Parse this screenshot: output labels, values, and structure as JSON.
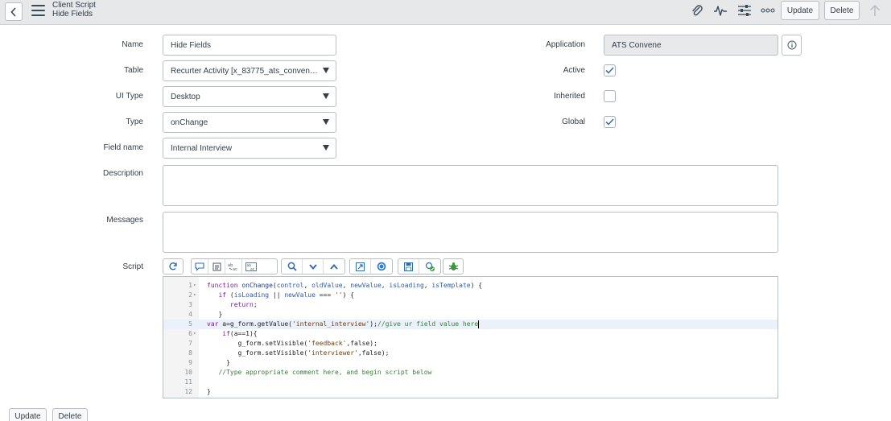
{
  "header": {
    "title": "Client Script",
    "subtitle": "Hide Fields",
    "update_label": "Update",
    "delete_label": "Delete"
  },
  "form": {
    "name_label": "Name",
    "name_value": "Hide Fields",
    "table_label": "Table",
    "table_value": "Recurter Activity [x_83775_ats_conven_r...",
    "ui_type_label": "UI Type",
    "ui_type_value": "Desktop",
    "type_label": "Type",
    "type_value": "onChange",
    "field_name_label": "Field name",
    "field_name_value": "Internal Interview",
    "description_label": "Description",
    "messages_label": "Messages",
    "script_label": "Script",
    "application_label": "Application",
    "application_value": "ATS Convene",
    "active_label": "Active",
    "active_checked": true,
    "inherited_label": "Inherited",
    "inherited_checked": false,
    "global_label": "Global",
    "global_checked": true
  },
  "script": {
    "lines": [
      {
        "n": "1",
        "fold": true
      },
      {
        "n": "2",
        "fold": true
      },
      {
        "n": "3",
        "fold": false
      },
      {
        "n": "4",
        "fold": false
      },
      {
        "n": "5",
        "fold": false
      },
      {
        "n": "6",
        "fold": true
      },
      {
        "n": "7",
        "fold": false
      },
      {
        "n": "8",
        "fold": false
      },
      {
        "n": "9",
        "fold": false
      },
      {
        "n": "10",
        "fold": false
      },
      {
        "n": "11",
        "fold": false
      },
      {
        "n": "12",
        "fold": false
      }
    ],
    "l1_kw": "function",
    "l1_fn": "onChange",
    "l1_open": "(",
    "l1_p1": "control",
    "l1_c1": ", ",
    "l1_p2": "oldValue",
    "l1_c2": ", ",
    "l1_p3": "newValue",
    "l1_c3": ", ",
    "l1_p4": "isLoading",
    "l1_c4": ", ",
    "l1_p5": "isTemplate",
    "l1_close": ") {",
    "l2_kw": "if",
    "l2_a": " (",
    "l2_v1": "isLoading",
    "l2_b": " || ",
    "l2_v2": "newValue",
    "l2_c": " === ",
    "l2_s": "''",
    "l2_d": ") {",
    "l3_kw": "return",
    "l3_end": ";",
    "l4": "}",
    "l5_kw": "var",
    "l5_a": " a=g_form.getValue(",
    "l5_s": "'internal_interview'",
    "l5_b": ");",
    "l5_cm": "//give ur field value here",
    "l6_kw": "if",
    "l6_rest": "(a==1){",
    "l7_a": "g_form.setVisible(",
    "l7_s": "'feedback'",
    "l7_b": ",false);",
    "l8_a": "g_form.setVisible(",
    "l8_s": "'interviewer'",
    "l8_b": ",false);",
    "l9": "}",
    "l10_cm": "//Type appropriate comment here, and begin script below",
    "l11": "",
    "l12": "}"
  },
  "footer": {
    "update_label": "Update",
    "delete_label": "Delete"
  },
  "colors": {
    "header_bg": "#e6e8ea",
    "check_color": "#3573b5",
    "keyword": "#7a1c9c",
    "comment": "#3d7a3d"
  }
}
